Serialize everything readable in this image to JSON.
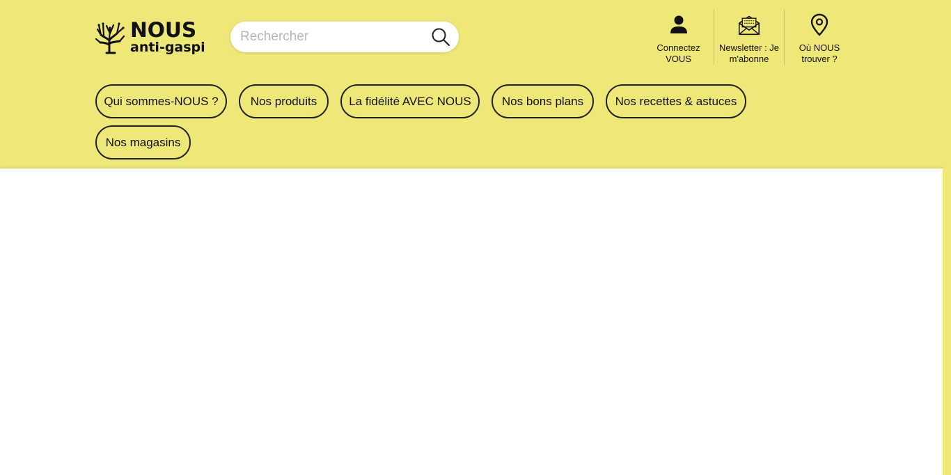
{
  "brand": {
    "name": "NOUS",
    "tagline": "anti-gaspi"
  },
  "search": {
    "placeholder": "Rechercher",
    "value": ""
  },
  "actions": {
    "account_line1": "Connectez",
    "account_line2": "VOUS",
    "newsletter_line1": "Newsletter : Je",
    "newsletter_line2": "m'abonne",
    "stores_line1": "Où NOUS",
    "stores_line2": "trouver ?"
  },
  "nav": {
    "items": [
      {
        "label": "Qui sommes-NOUS ?"
      },
      {
        "label": "Nos produits"
      },
      {
        "label": "La fidélité AVEC NOUS"
      },
      {
        "label": "Nos bons plans"
      },
      {
        "label": "Nos recettes & astuces"
      },
      {
        "label": "Nos magasins"
      }
    ]
  },
  "colors": {
    "header_bg": "#ede877",
    "text": "#111111",
    "content_bg": "#ffffff"
  },
  "icons": {
    "logo": "tree-icon",
    "search": "search-icon",
    "account": "user-icon",
    "newsletter": "envelope-icon",
    "stores": "map-pin-icon"
  }
}
